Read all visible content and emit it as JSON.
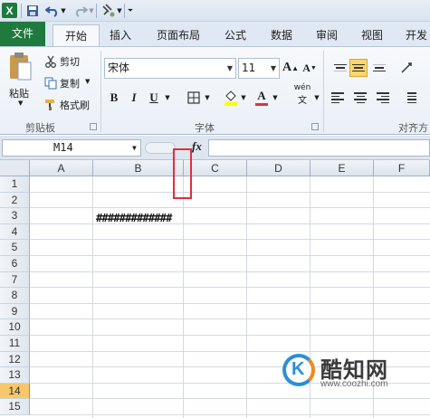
{
  "app": {
    "accent": "#1f7a3d",
    "selected_row_color": "#f6c76b",
    "highlight_box_color": "#e0303a"
  },
  "quick_access": {
    "icons": [
      "excel-logo",
      "save-icon",
      "undo-icon",
      "redo-icon",
      "format-painter-icon",
      "customize-icon"
    ],
    "logo_letter": "X"
  },
  "tabs": [
    {
      "label": "文件"
    },
    {
      "label": "开始"
    },
    {
      "label": "插入"
    },
    {
      "label": "页面布局"
    },
    {
      "label": "公式"
    },
    {
      "label": "数据"
    },
    {
      "label": "审阅"
    },
    {
      "label": "视图"
    },
    {
      "label": "开发"
    }
  ],
  "ribbon": {
    "clipboard": {
      "paste_label": "粘贴",
      "cut_label": "剪切",
      "copy_label": "复制",
      "painter_label": "格式刷",
      "group_label": "剪贴板"
    },
    "font": {
      "font_name": "宋体",
      "font_size": "11",
      "grow": "A",
      "shrink": "A",
      "bold": "B",
      "italic": "I",
      "underline": "U",
      "font_color_letter": "A",
      "phonetic": "wén",
      "group_label": "字体"
    },
    "alignment": {
      "group_label": "对齐方"
    }
  },
  "formula_bar": {
    "name_box": "M14",
    "fx_label": "fx",
    "value": ""
  },
  "grid": {
    "columns": [
      "A",
      "B",
      "C",
      "D",
      "E",
      "F"
    ],
    "rows": [
      "1",
      "2",
      "3",
      "4",
      "5",
      "6",
      "7",
      "8",
      "9",
      "10",
      "11",
      "12",
      "13",
      "14",
      "15"
    ],
    "selected_row": "14",
    "cells": {
      "B3": "#############"
    }
  },
  "watermark": {
    "logo_letter": "K",
    "title": "酷知网",
    "url": "www.coozhi.com"
  }
}
